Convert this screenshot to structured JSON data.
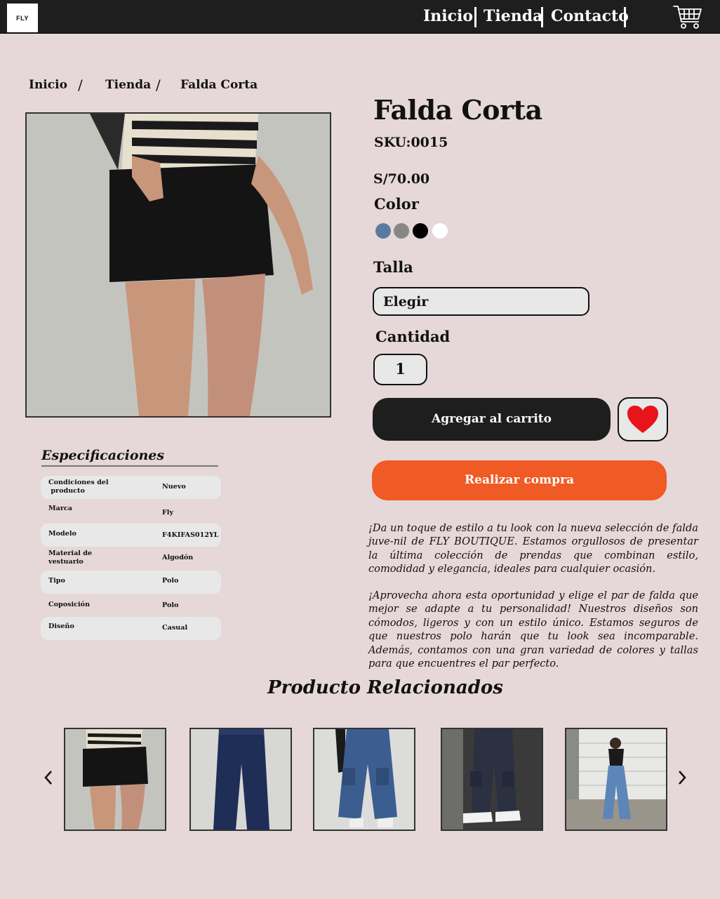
{
  "header": {
    "logo": "FLY",
    "nav": [
      "Inicio",
      "Tienda",
      "Contacto"
    ],
    "cart_icon": "shopping-cart-icon"
  },
  "breadcrumb": {
    "items": [
      "Inicio",
      "Tienda",
      "Falda Corta"
    ],
    "separator": "/"
  },
  "product": {
    "title": "Falda Corta",
    "sku": "SKU:0015",
    "price": "S/70.00",
    "color_label": "Color",
    "colors": [
      "#5a7b9f",
      "#878787",
      "#000000",
      "#ffffff"
    ],
    "size_label": "Talla",
    "size_value": "Elegir",
    "quantity_label": "Cantidad",
    "quantity": "1",
    "add_to_cart": "Agregar al carrito",
    "buy_now": "Realizar compra",
    "favorite_icon": "heart-icon",
    "description_1": "¡Da un toque de estilo a tu look con la nueva selección de falda juve-nil de FLY BOUTIQUE. Estamos orgullosos de presentar la última colección de prendas que combinan estilo, comodidad y elegancia, ideales para cualquier ocasión.",
    "description_2": "¡Aprovecha ahora esta oportunidad y elige el par de falda que mejor se adapte a tu personalidad! Nuestros diseños son cómodos, ligeros y con un estilo único. Estamos seguros de que nuestros polo harán que tu look sea incomparable. Además, contamos con una gran variedad de colores y tallas para que encuentres el par perfecto."
  },
  "specs": {
    "title": "Especificaciones",
    "rows": [
      {
        "key": "Condiciones del\n producto",
        "value": "Nuevo"
      },
      {
        "key": "Marca",
        "value": "Fly"
      },
      {
        "key": "Modelo",
        "value": "F4KIFAS012YL"
      },
      {
        "key": "Material de\nvestuario",
        "value": "Algodón"
      },
      {
        "key": "Tipo",
        "value": "Polo"
      },
      {
        "key": "Coposición",
        "value": "Polo"
      },
      {
        "key": "Diseño",
        "value": "Casual"
      }
    ]
  },
  "related": {
    "title": "Producto Relacionados",
    "prev_icon": "chevron-left-icon",
    "next_icon": "chevron-right-icon"
  },
  "colors": {
    "header_bg": "#1e1e1e",
    "page_bg": "#e6d7d9",
    "buy_button": "#f05a24",
    "heart": "#e8141c"
  }
}
